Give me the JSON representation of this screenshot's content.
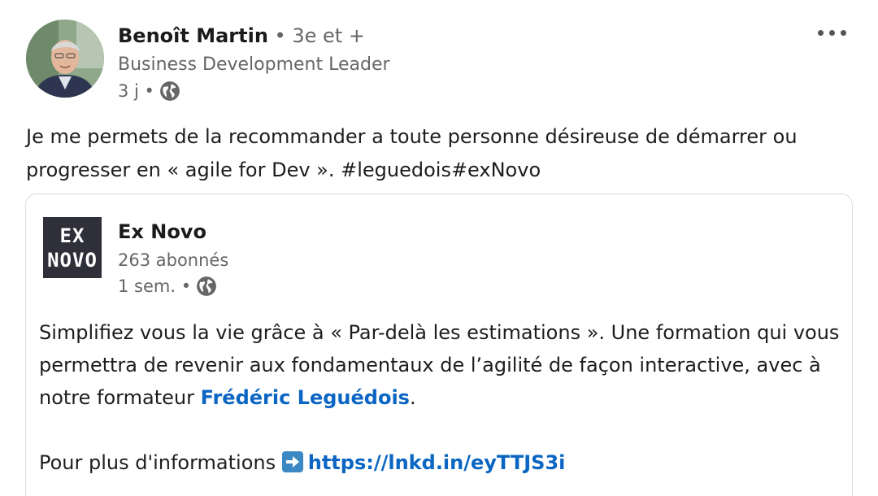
{
  "post": {
    "author": {
      "name": "Benoît Martin",
      "degree": "• 3e et +",
      "headline": "Business Development Leader",
      "time": "3 j •"
    },
    "text": "Je me permets de la recommander a toute personne désireuse de démarrer ou progresser en « agile for Dev ». #leguedois#exNovo"
  },
  "shared": {
    "company": {
      "logo_line1": "EX",
      "logo_line2": "NOVO",
      "name": "Ex Novo",
      "followers": "263 abonnés",
      "time": "1 sem. •"
    },
    "paragraph1_before": "Simplifiez vous la vie grâce à « Par-delà les estimations ». Une formation qui vous permettra de revenir aux fondamentaux de l’agilité de façon interactive, avec à notre formateur ",
    "mention": "Frédéric Leguédois",
    "paragraph1_after": ".",
    "paragraph2_before": "Pour plus d'informations ",
    "link": "https://lnkd.in/eyTTJS3i"
  },
  "icons": {
    "globe": "globe-icon",
    "more": "more-options-icon",
    "arrow": "right-arrow-emoji-icon"
  },
  "colors": {
    "link": "#0a66c2",
    "logo_bg": "#2f2f3a",
    "secondary_text": "#666666"
  }
}
